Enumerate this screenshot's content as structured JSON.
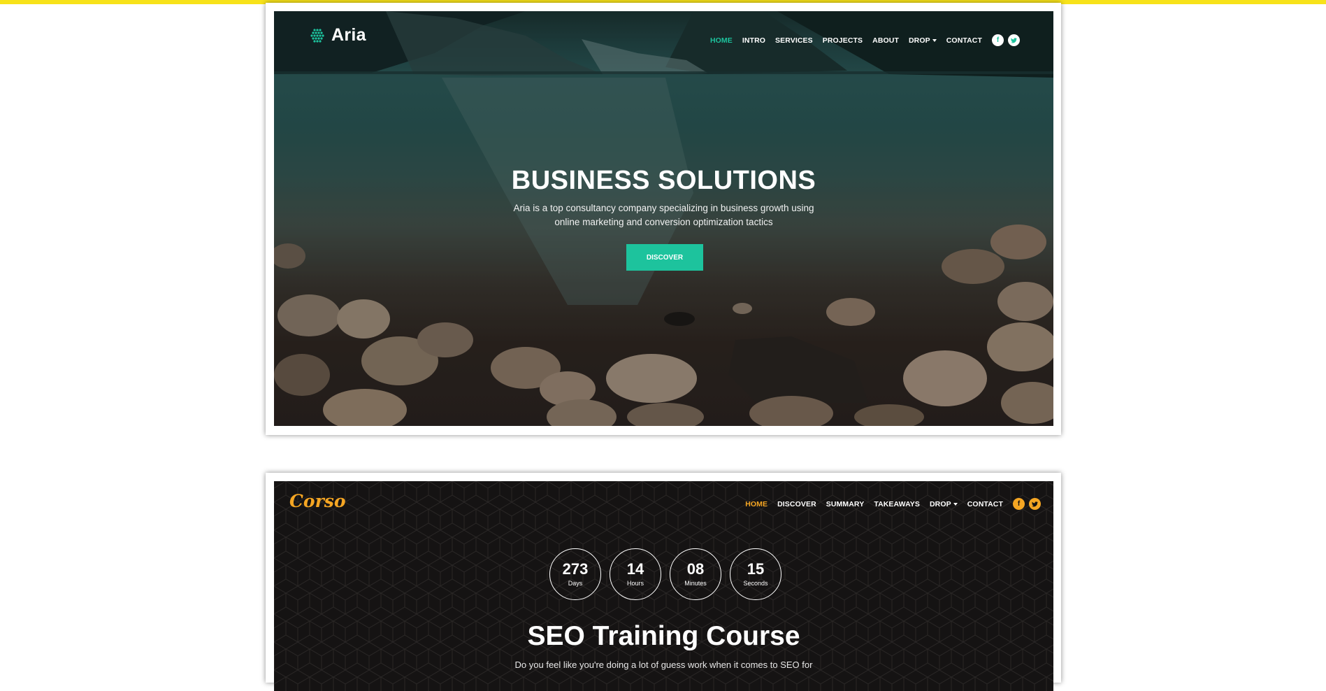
{
  "colors": {
    "top_bar": "#f7e21a",
    "aria_accent": "#1dc39d",
    "corso_accent": "#f5a623",
    "corso_background": "#151313"
  },
  "aria": {
    "logo_text": "Aria",
    "nav": {
      "items": [
        "HOME",
        "INTRO",
        "SERVICES",
        "PROJECTS",
        "ABOUT",
        "DROP",
        "CONTACT"
      ],
      "active": "HOME",
      "social_icons": [
        "facebook-icon",
        "twitter-icon"
      ]
    },
    "hero": {
      "title": "BUSINESS SOLUTIONS",
      "subtitle_line1": "Aria is a top consultancy company specializing in business growth using",
      "subtitle_line2": "online marketing and conversion optimization tactics",
      "button_label": "DISCOVER"
    }
  },
  "corso": {
    "logo_text": "Corso",
    "nav": {
      "items": [
        "HOME",
        "DISCOVER",
        "SUMMARY",
        "TAKEAWAYS",
        "DROP",
        "CONTACT"
      ],
      "active": "HOME",
      "social_icons": [
        "facebook-icon",
        "twitter-icon"
      ]
    },
    "countdown": [
      {
        "value": "273",
        "label": "Days"
      },
      {
        "value": "14",
        "label": "Hours"
      },
      {
        "value": "08",
        "label": "Minutes"
      },
      {
        "value": "15",
        "label": "Seconds"
      }
    ],
    "hero": {
      "title": "SEO Training Course",
      "subtitle": "Do you feel like you're doing a lot of guess work when it comes to SEO for"
    }
  }
}
